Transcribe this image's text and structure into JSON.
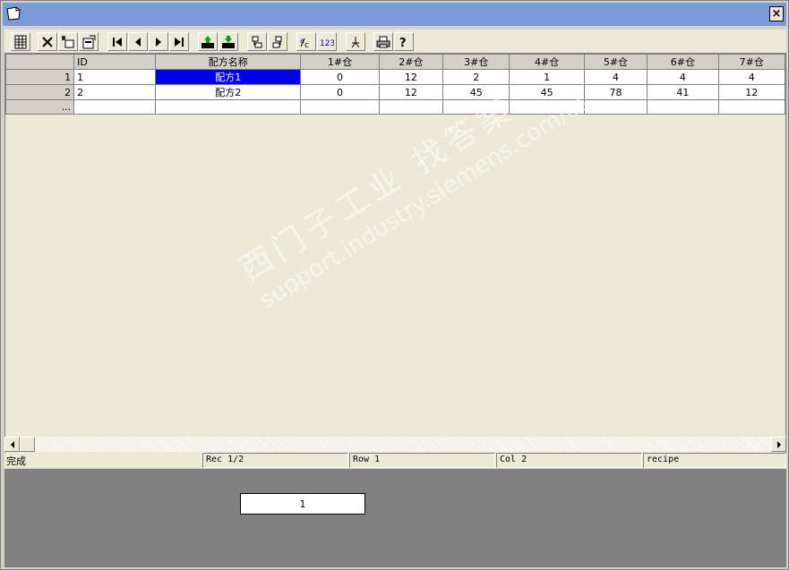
{
  "titlebar": {
    "close_label": "×"
  },
  "toolbar": {
    "buttons": [
      "table-view-icon",
      "delete-icon",
      "new-row-icon",
      "properties-icon",
      "first-record-icon",
      "previous-record-icon",
      "next-record-icon",
      "last-record-icon",
      "import-icon",
      "export-icon",
      "copy-up-icon",
      "copy-down-icon",
      "rename-icon",
      "number-format-icon",
      "pin-icon",
      "print-icon",
      "help-icon"
    ]
  },
  "grid": {
    "columns": [
      "ID",
      "配方名称",
      "1#仓",
      "2#仓",
      "3#仓",
      "4#仓",
      "5#仓",
      "6#仓",
      "7#仓"
    ],
    "rows": [
      {
        "num": "1",
        "cells": [
          "1",
          "配方1",
          "0",
          "12",
          "2",
          "1",
          "4",
          "4",
          "4"
        ]
      },
      {
        "num": "2",
        "cells": [
          "2",
          "配方2",
          "0",
          "12",
          "45",
          "45",
          "78",
          "41",
          "12"
        ]
      }
    ],
    "new_row_marker": "..."
  },
  "watermark": {
    "cn": "西门子工业  找答案",
    "url": "support.industry.siemens.com/cs"
  },
  "status": {
    "main": "完成",
    "rec": "Rec 1/2",
    "row": "Row 1",
    "col": "Col 2",
    "name": "recipe"
  },
  "value_box": "1",
  "colors": {
    "titlebar": "#7b9ad9",
    "selected_cell": "#0000f0",
    "panel": "#ece9d8",
    "lower_area": "#808080"
  }
}
